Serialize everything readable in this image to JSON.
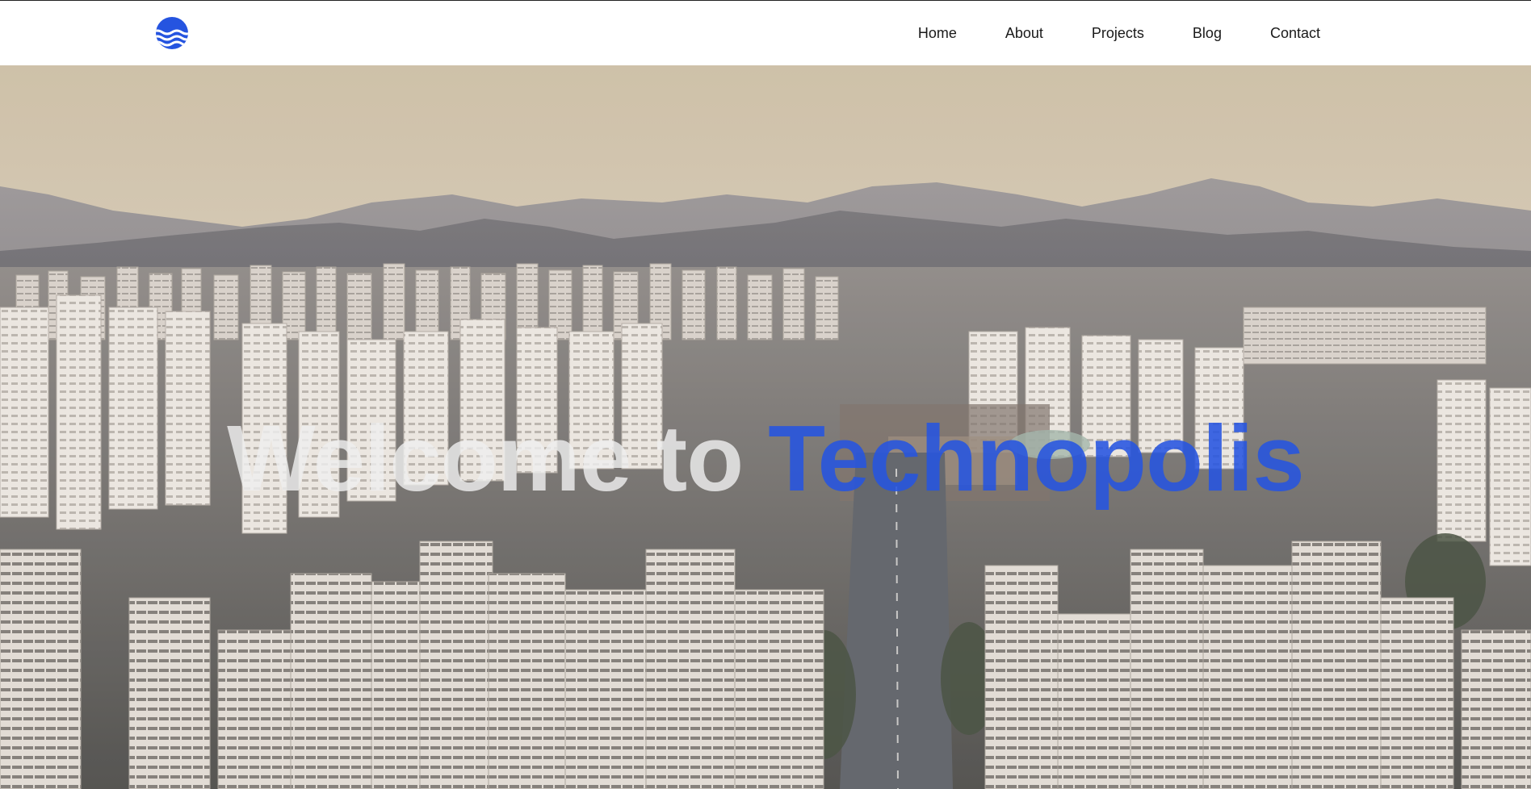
{
  "header": {
    "logo_icon": "waves-logo-icon",
    "nav": [
      {
        "label": "Home"
      },
      {
        "label": "About"
      },
      {
        "label": "Projects"
      },
      {
        "label": "Blog"
      },
      {
        "label": "Contact"
      }
    ]
  },
  "hero": {
    "title_prefix": "Welcome to ",
    "title_highlight": "Technopolis",
    "background": "aerial city skyline with apartment towers and mountains"
  },
  "colors": {
    "accent": "#2554e0",
    "nav_text": "#1a1a1a",
    "title_light": "#eeeeee"
  }
}
